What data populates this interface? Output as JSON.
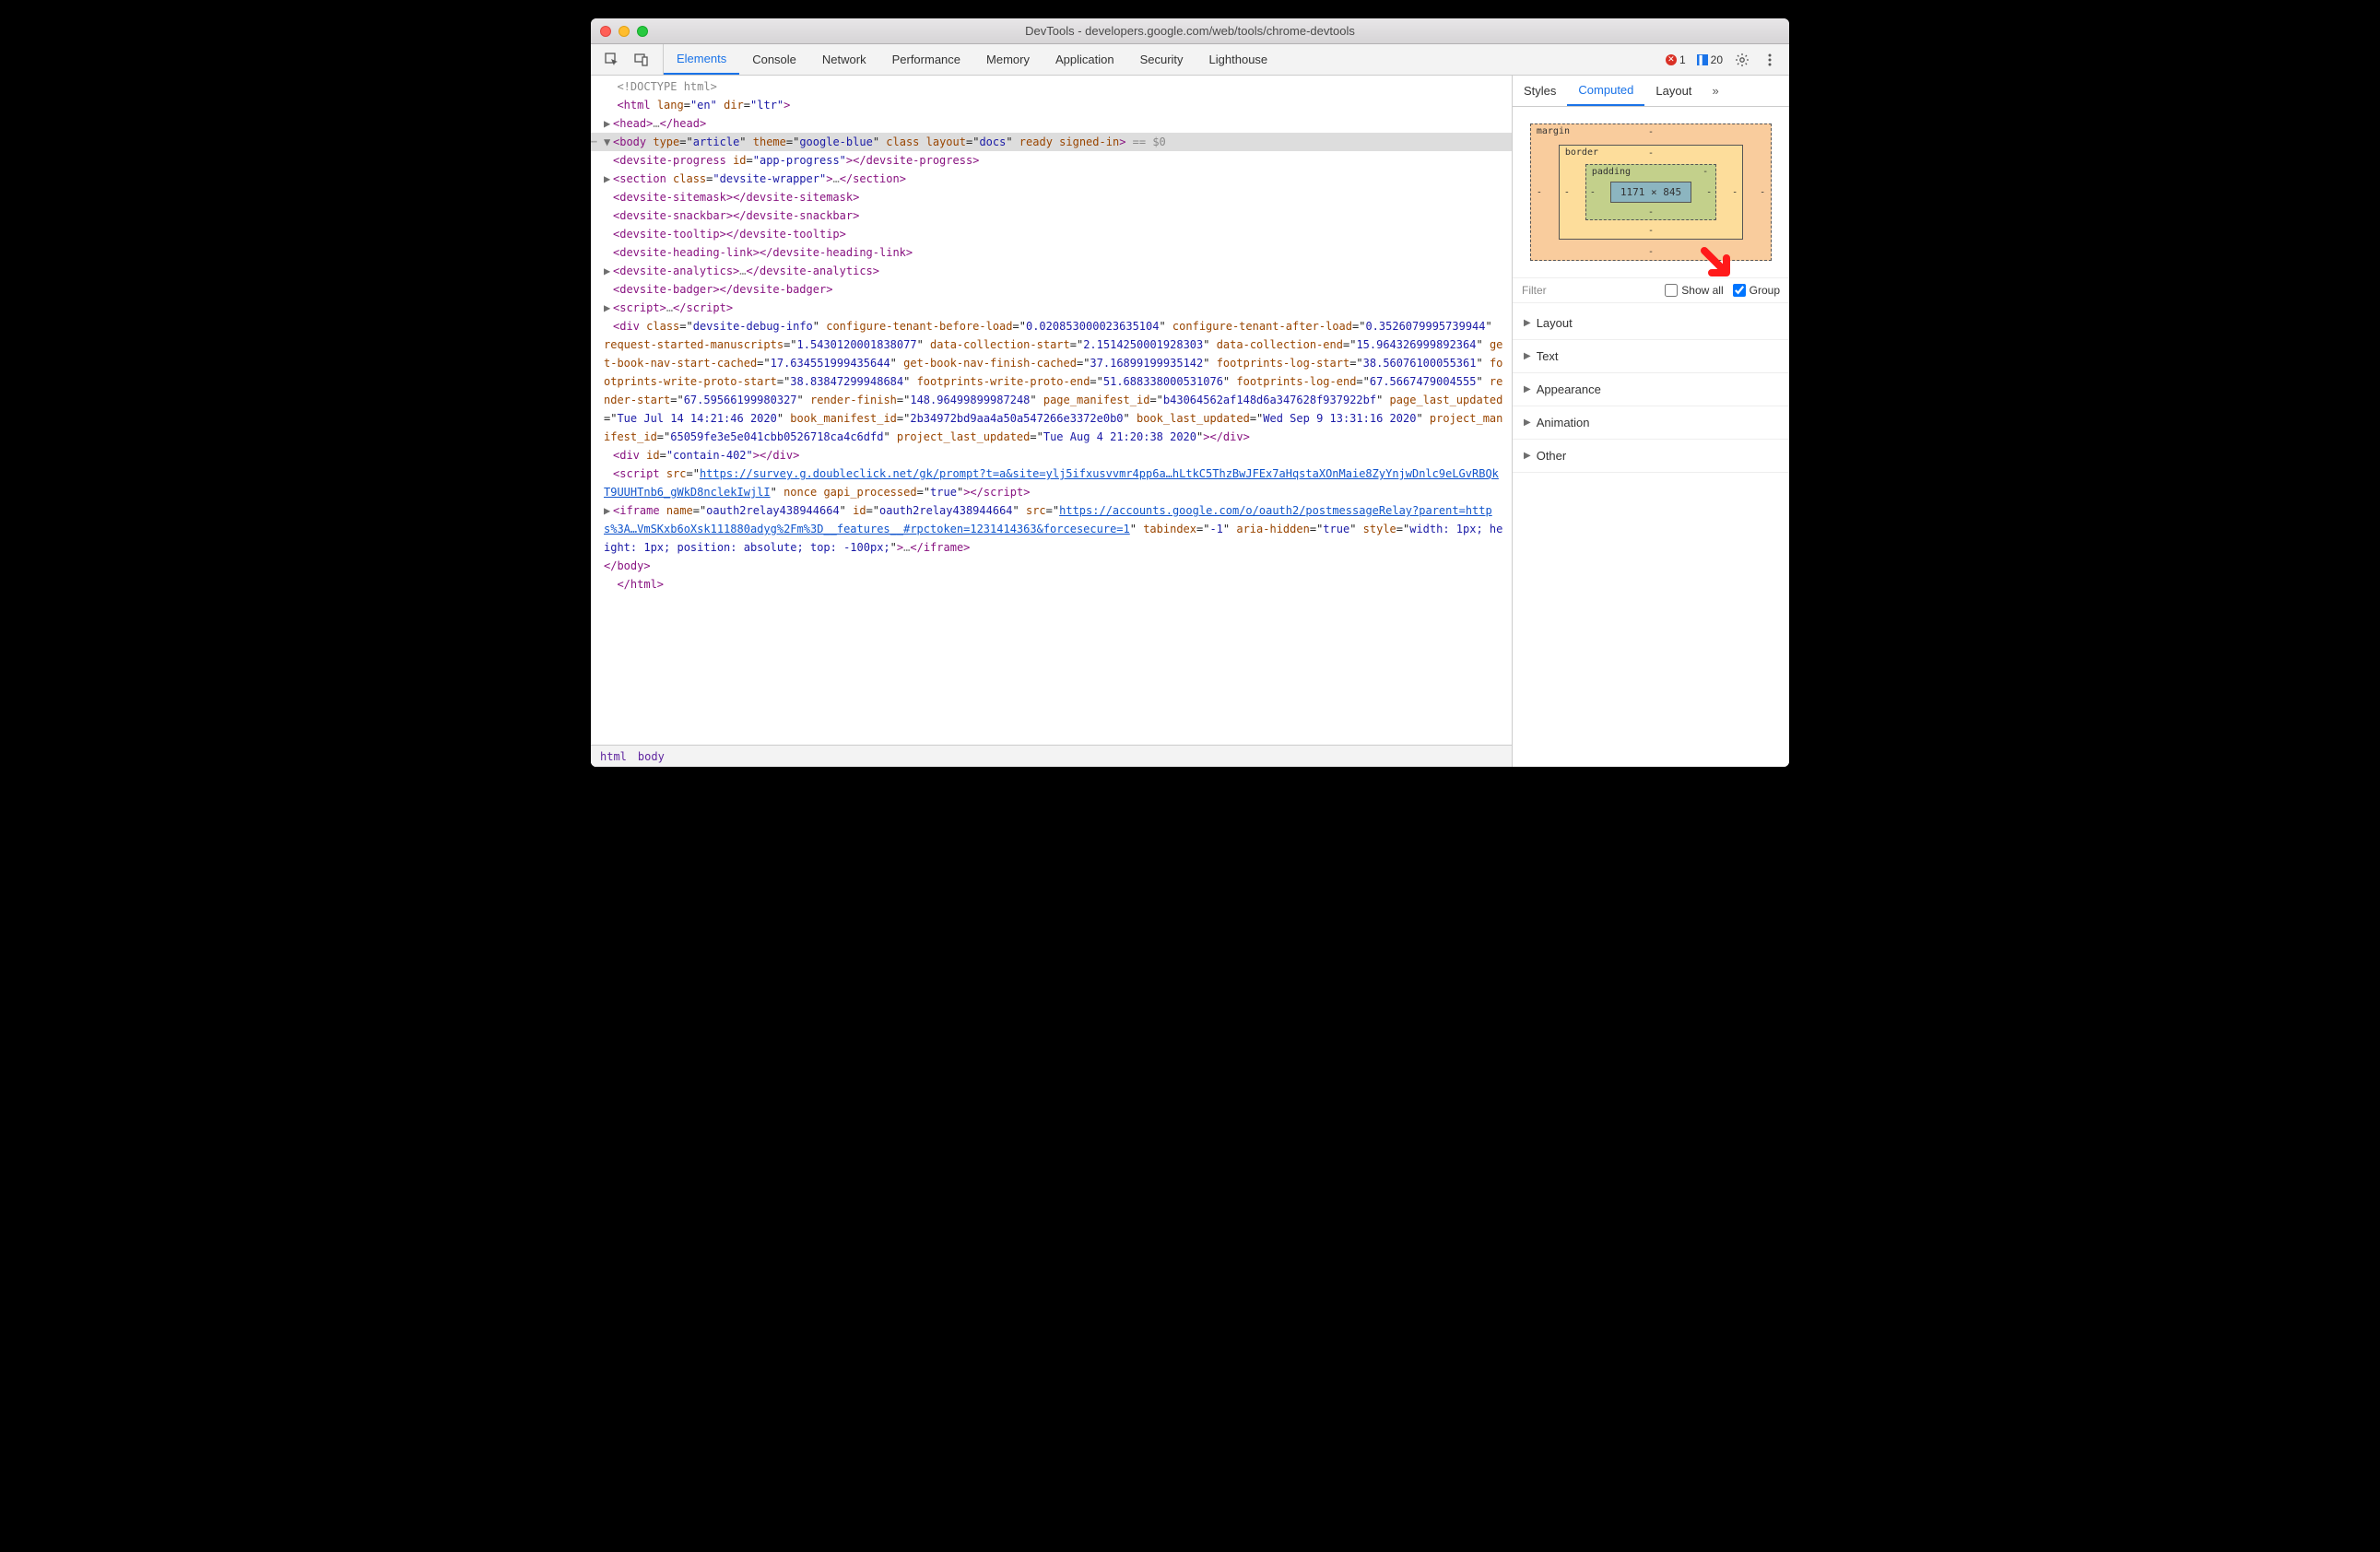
{
  "window": {
    "title": "DevTools - developers.google.com/web/tools/chrome-devtools"
  },
  "main_tabs": [
    "Elements",
    "Console",
    "Network",
    "Performance",
    "Memory",
    "Application",
    "Security",
    "Lighthouse"
  ],
  "main_tab_active": 0,
  "errors": {
    "error_count": "1",
    "message_count": "20"
  },
  "side_tabs": [
    "Styles",
    "Computed",
    "Layout"
  ],
  "side_tab_active": 1,
  "box_model": {
    "margin_label": "margin",
    "border_label": "border",
    "padding_label": "padding",
    "content": "1171 × 845",
    "dash": "-"
  },
  "filter": {
    "placeholder": "Filter",
    "show_all_label": "Show all",
    "show_all_checked": false,
    "group_label": "Group",
    "group_checked": true
  },
  "computed_groups": [
    "Layout",
    "Text",
    "Appearance",
    "Animation",
    "Other"
  ],
  "breadcrumb": [
    "html",
    "body"
  ],
  "dom": {
    "doctype": "<!DOCTYPE html>",
    "html_open": {
      "tag": "html",
      "attrs": [
        [
          "lang",
          "en"
        ],
        [
          "dir",
          "ltr"
        ]
      ]
    },
    "head": "head",
    "body_open": {
      "tag": "body",
      "attrs": [
        [
          "type",
          "article"
        ],
        [
          "theme",
          "google-blue"
        ],
        [
          "class",
          ""
        ],
        [
          "layout",
          "docs"
        ],
        [
          "ready",
          ""
        ],
        [
          "signed-in",
          ""
        ]
      ],
      "tail": " == $0"
    },
    "children": [
      {
        "type": "simple",
        "open": "devsite-progress",
        "attrs": [
          [
            "id",
            "app-progress"
          ]
        ],
        "close": "devsite-progress"
      },
      {
        "type": "expand",
        "open": "section",
        "attrs": [
          [
            "class",
            "devsite-wrapper"
          ]
        ],
        "close": "section"
      },
      {
        "type": "simple",
        "open": "devsite-sitemask",
        "close": "devsite-sitemask"
      },
      {
        "type": "simple",
        "open": "devsite-snackbar",
        "close": "devsite-snackbar"
      },
      {
        "type": "simple",
        "open": "devsite-tooltip",
        "close": "devsite-tooltip"
      },
      {
        "type": "simple",
        "open": "devsite-heading-link",
        "close": "devsite-heading-link"
      },
      {
        "type": "expand",
        "open": "devsite-analytics",
        "close": "devsite-analytics"
      },
      {
        "type": "simple",
        "open": "devsite-badger",
        "close": "devsite-badger"
      },
      {
        "type": "expand",
        "open": "script",
        "close": "script"
      }
    ],
    "div_debug": {
      "tag": "div",
      "segments": [
        [
          "class",
          "devsite-debug-info"
        ],
        [
          "configure-tenant-before-load",
          "0.020853000023635104"
        ],
        [
          "configure-tenant-after-load",
          "0.3526079995739944"
        ],
        [
          "request-started-manuscripts",
          "1.5430120001838077"
        ],
        [
          "data-collection-start",
          "2.1514250001928303"
        ],
        [
          "data-collection-end",
          "15.964326999892364"
        ],
        [
          "get-book-nav-start-cached",
          "17.634551999435644"
        ],
        [
          "get-book-nav-finish-cached",
          "37.16899199935142"
        ],
        [
          "footprints-log-start",
          "38.56076100055361"
        ],
        [
          "footprints-write-proto-start",
          "38.83847299948684"
        ],
        [
          "footprints-write-proto-end",
          "51.688338000531076"
        ],
        [
          "footprints-log-end",
          "67.5667479004555"
        ],
        [
          "render-start",
          "67.59566199980327"
        ],
        [
          "render-finish",
          "148.96499899987248"
        ],
        [
          "page_manifest_id",
          "b43064562af148d6a347628f937922bf"
        ],
        [
          "page_last_updated",
          "Tue Jul 14 14:21:46 2020"
        ],
        [
          "book_manifest_id",
          "2b34972bd9aa4a50a547266e3372e0b0"
        ],
        [
          "book_last_updated",
          "Wed Sep  9 13:31:16 2020"
        ],
        [
          "project_manifest_id",
          "65059fe3e5e041cbb0526718ca4c6dfd"
        ],
        [
          "project_last_updated",
          "Tue Aug  4 21:20:38 2020"
        ]
      ],
      "close": "div"
    },
    "div_contain": {
      "tag": "div",
      "attrs": [
        [
          "id",
          "contain-402"
        ]
      ],
      "close": "div"
    },
    "script_survey": {
      "tag": "script",
      "src": "https://survey.g.doubleclick.net/gk/prompt?t=a&site=ylj5ifxusvvmr4pp6a…hLtkC5ThzBwJFEx7aHqstaXOnMaie8ZyYnjwDnlc9eLGvRBQkT9UUHTnb6_gWkD8nclekIwjlI",
      "tail_attrs": [
        [
          "nonce",
          ""
        ],
        [
          "gapi_processed",
          "true"
        ]
      ],
      "close": "script"
    },
    "iframe": {
      "tag": "iframe",
      "pre_attrs": [
        [
          "name",
          "oauth2relay438944664"
        ],
        [
          "id",
          "oauth2relay438944664"
        ]
      ],
      "src": "https://accounts.google.com/o/oauth2/postmessageRelay?parent=https%3A…VmSKxb6oXsk111880adyg%2Fm%3D__features__#rpctoken=1231414363&forcesecure=1",
      "post_attrs": [
        [
          "tabindex",
          "-1"
        ],
        [
          "aria-hidden",
          "true"
        ],
        [
          "style",
          "width: 1px; height: 1px; position: absolute; top: -100px;"
        ]
      ],
      "close": "iframe"
    },
    "body_close": "body",
    "html_close": "html"
  }
}
